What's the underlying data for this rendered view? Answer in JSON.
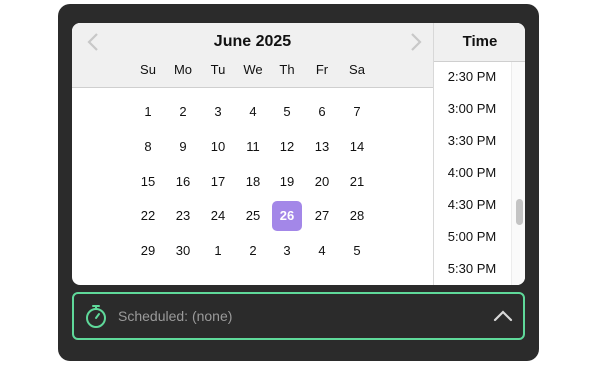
{
  "calendar": {
    "month_label": "June 2025",
    "weekdays": [
      "Su",
      "Mo",
      "Tu",
      "We",
      "Th",
      "Fr",
      "Sa"
    ],
    "weeks": [
      [
        "1",
        "2",
        "3",
        "4",
        "5",
        "6",
        "7"
      ],
      [
        "8",
        "9",
        "10",
        "11",
        "12",
        "13",
        "14"
      ],
      [
        "15",
        "16",
        "17",
        "18",
        "19",
        "20",
        "21"
      ],
      [
        "22",
        "23",
        "24",
        "25",
        "26",
        "27",
        "28"
      ],
      [
        "29",
        "30",
        "1",
        "2",
        "3",
        "4",
        "5"
      ]
    ],
    "selected_day": "26",
    "prev_icon": "chevron-left-icon",
    "next_icon": "chevron-right-icon"
  },
  "time": {
    "header": "Time",
    "items": [
      "2:30 PM",
      "3:00 PM",
      "3:30 PM",
      "4:00 PM",
      "4:30 PM",
      "5:00 PM",
      "5:30 PM"
    ]
  },
  "scheduled": {
    "label": "Scheduled: (none)",
    "icon": "stopwatch-icon",
    "toggle_icon": "chevron-up-icon"
  },
  "colors": {
    "panel_bg": "#2b2b2b",
    "selected_day": "#a387e8",
    "accent_green": "#5fd99a"
  }
}
